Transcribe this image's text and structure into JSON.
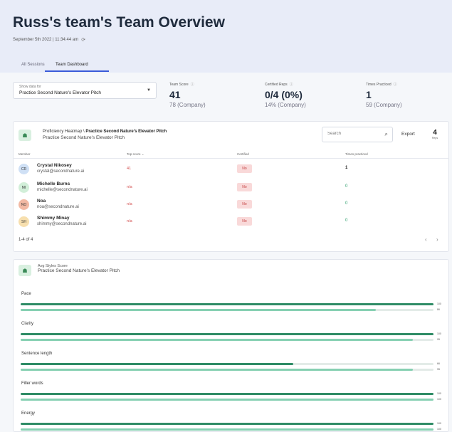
{
  "page": {
    "title": "Russ's team's Team Overview",
    "date": "September 5th 2022 | 11:34:44 am"
  },
  "tabs": [
    {
      "label": "All Sessions",
      "active": false
    },
    {
      "label": "Team Dashboard",
      "active": true
    }
  ],
  "filter": {
    "label": "Show data for",
    "value": "Practice Second Nature's Elevator Pitch"
  },
  "stats": [
    {
      "label": "Team Score",
      "value": "41",
      "sub": "78 (Company)"
    },
    {
      "label": "Certified Reps",
      "value": "0/4 (0%)",
      "sub": "14% (Company)"
    },
    {
      "label": "Times Practiced",
      "value": "1",
      "sub": "59 (Company)"
    }
  ],
  "heatmap": {
    "title_prefix": "Proficiency Heatmap \\",
    "title_bold": "Practice Second Nature's Elevator Pitch",
    "subtitle": "Practice Second Nature's Elevator Pitch",
    "search_placeholder": "Search",
    "export_label": "Export",
    "reps_count": "4",
    "reps_label": "Reps",
    "columns": {
      "member": "Member",
      "top_score": "Top score",
      "certified": "Certified",
      "times": "Times practiced"
    },
    "rows": [
      {
        "initials": "CR",
        "name": "Crystal Nikosey",
        "email": "crystal@secondnature.ai",
        "score": "41",
        "certified": "No",
        "times": "1",
        "avatar_color": "#cfe0f5"
      },
      {
        "initials": "MI",
        "name": "Michelle Burns",
        "email": "michelle@secondnature.ai",
        "score": "n/a",
        "certified": "No",
        "times": "0",
        "avatar_color": "#d2efd9"
      },
      {
        "initials": "NO",
        "name": "Noa",
        "email": "noa@secondnature.ai",
        "score": "n/a",
        "certified": "No",
        "times": "0",
        "avatar_color": "#f2b9a3"
      },
      {
        "initials": "SH",
        "name": "Shimmy Minay",
        "email": "shimmy@secondnature.ai",
        "score": "n/a",
        "certified": "No",
        "times": "0",
        "avatar_color": "#f7dfae"
      }
    ],
    "pagination": "1-4 of 4"
  },
  "styles": {
    "title": "Avg Styles Score",
    "subtitle": "Practice Second Nature's Elevator Pitch",
    "metrics": [
      {
        "label": "Pace",
        "team": 100,
        "company": 86
      },
      {
        "label": "Clarity",
        "team": 100,
        "company": 95
      },
      {
        "label": "Sentence length",
        "team": 66,
        "company": 95
      },
      {
        "label": "Filler words",
        "team": 100,
        "company": 100
      },
      {
        "label": "Energy",
        "team": 100,
        "company": 100
      }
    ]
  },
  "icons": {
    "refresh": "refresh-icon",
    "info": "info-icon",
    "search": "search-icon",
    "team": "team-icon",
    "chevron_down": "chevron-down-icon"
  }
}
